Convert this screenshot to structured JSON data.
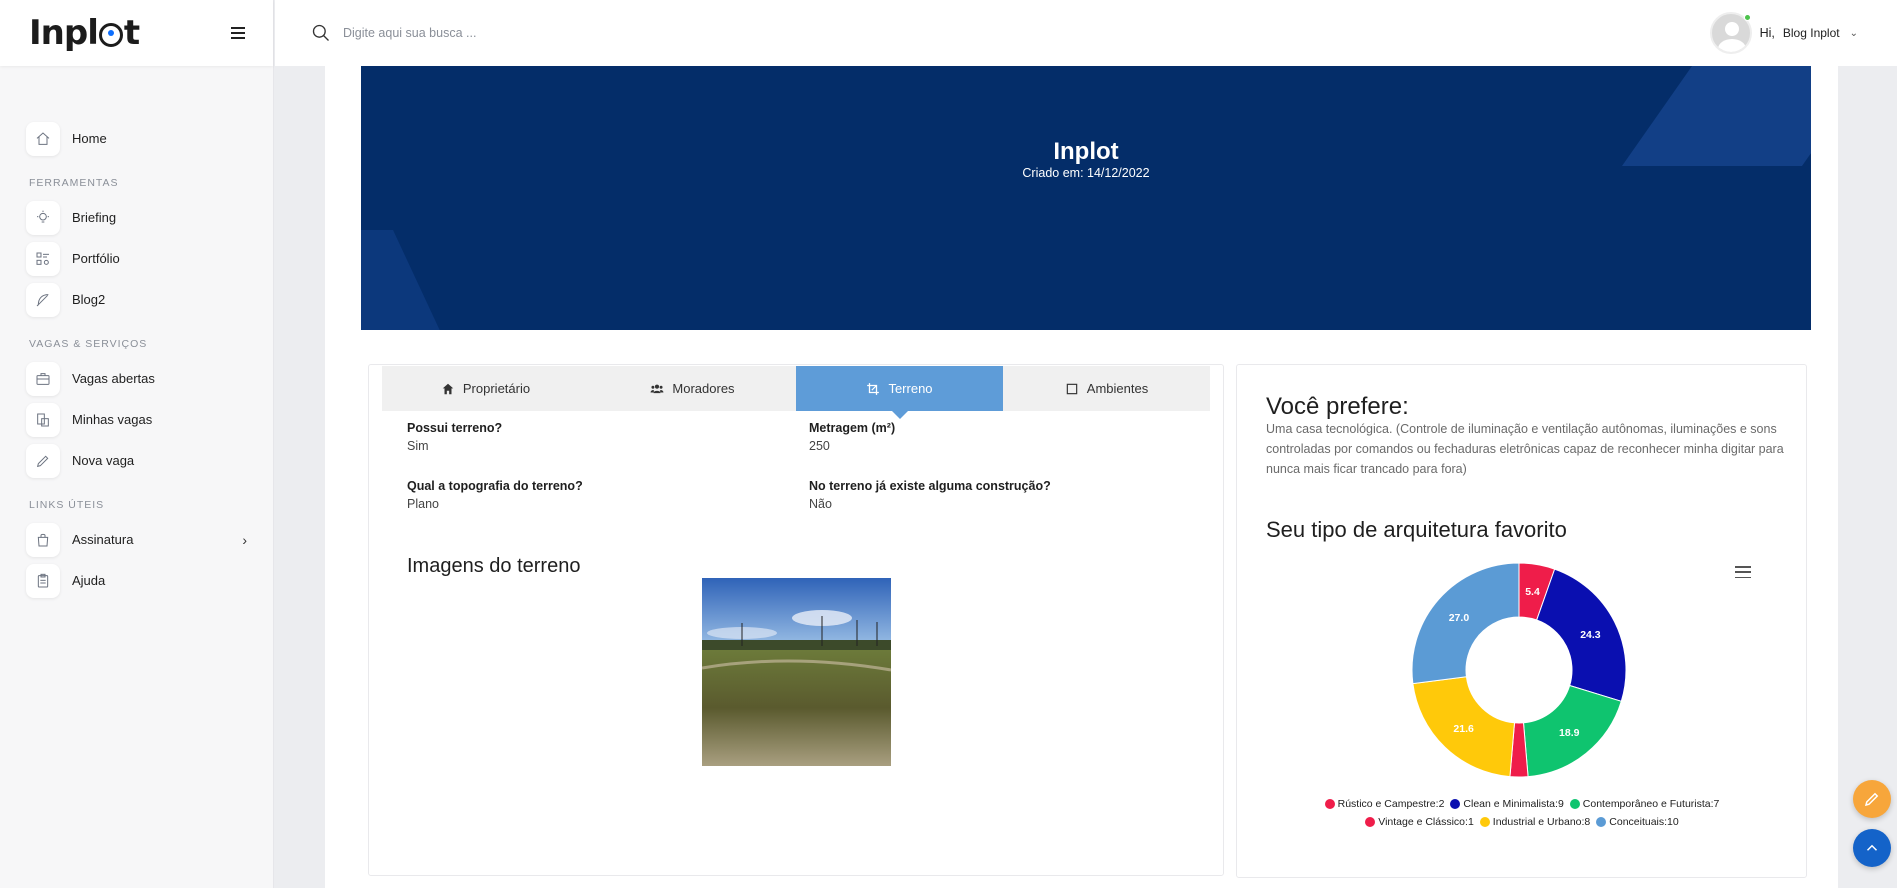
{
  "sidebar": {
    "logo": "Inplot",
    "items": [
      {
        "label": "Home",
        "icon": "home-icon"
      },
      {
        "section": "FERRAMENTAS"
      },
      {
        "label": "Briefing",
        "icon": "bulb-icon"
      },
      {
        "label": "Portfólio",
        "icon": "portfolio-icon"
      },
      {
        "label": "Blog2",
        "icon": "feather-icon"
      },
      {
        "section": "VAGAS & SERVIÇOS"
      },
      {
        "label": "Vagas abertas",
        "icon": "briefcase-icon"
      },
      {
        "label": "Minhas vagas",
        "icon": "jobs-icon"
      },
      {
        "label": "Nova vaga",
        "icon": "pencil-icon"
      },
      {
        "section": "LINKS ÚTEIS"
      },
      {
        "label": "Assinatura",
        "icon": "bag-icon"
      },
      {
        "label": "Ajuda",
        "icon": "clipboard-icon"
      }
    ]
  },
  "topbar": {
    "search_placeholder": "Digite aqui sua busca ...",
    "greeting": "Hi,",
    "user_name": "Blog Inplot"
  },
  "banner": {
    "title": "Inplot",
    "subtitle": "Criado em: 14/12/2022"
  },
  "tabs": [
    {
      "label": "Proprietário",
      "icon": "home-icon"
    },
    {
      "label": "Moradores",
      "icon": "users-icon"
    },
    {
      "label": "Terreno",
      "icon": "crop-icon",
      "active": true
    },
    {
      "label": "Ambientes",
      "icon": "square-icon"
    }
  ],
  "terreno": {
    "fields": [
      {
        "label": "Possui terreno?",
        "value": "Sim"
      },
      {
        "label": "Metragem (m²)",
        "value": "250"
      },
      {
        "label": "Qual a topografia do terreno?",
        "value": "Plano"
      },
      {
        "label": "No terreno já existe alguma construção?",
        "value": "Não"
      }
    ],
    "images_title": "Imagens do terreno"
  },
  "prefer": {
    "title": "Você prefere:",
    "text": "Uma casa tecnológica. (Controle de iluminação e ventilação autônomas, iluminações e sons controladas por comandos ou fechaduras eletrônicas capaz de reconhecer minha digitar para nunca mais ficar trancado para fora)"
  },
  "chart_data": {
    "type": "pie",
    "title": "Seu tipo de arquitetura favorito",
    "categories": [
      "Rústico e Campestre",
      "Clean e Minimalista",
      "Contemporâneo e Futurista",
      "Vintage e Clássico",
      "Industrial e Urbano",
      "Conceituais"
    ],
    "values": [
      2,
      9,
      7,
      1,
      8,
      10
    ],
    "percent_labels": [
      "5.4",
      "24.3",
      "18.9",
      "",
      "21.6",
      "27.0"
    ],
    "colors": [
      "#ef1d4a",
      "#0a0fb0",
      "#0fc46f",
      "#ef1d4a",
      "#ffc90a",
      "#5b9bd5"
    ],
    "legend_labels": [
      "Rústico e Campestre:2",
      "Clean e Minimalista:9",
      "Contemporâneo e Futurista:7",
      "Vintage e Clássico:1",
      "Industrial e Urbano:8",
      "Conceituais:10"
    ],
    "legend_position": "bottom"
  }
}
